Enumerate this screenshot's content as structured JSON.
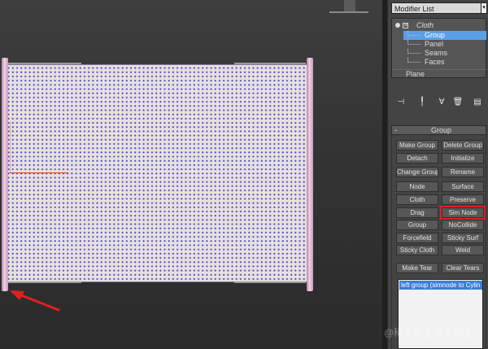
{
  "modifier_list": {
    "label": "Modifier List",
    "arrow": "▾"
  },
  "stack": {
    "root": "Cloth",
    "sub_objects": [
      "Group",
      "Panel",
      "Seams",
      "Faces"
    ],
    "selected_index": 0,
    "base": "Plane",
    "plus_glyph": "⊞"
  },
  "toolbar_icons": [
    "pin-stack-icon",
    "show-end-result-icon",
    "make-unique-icon",
    "remove-modifier-icon",
    "configure-sets-icon"
  ],
  "rollout": {
    "collapse": "-",
    "title": "Group",
    "buttons": [
      [
        "Make Group",
        "Delete Group"
      ],
      [
        "Detach",
        "Initialize"
      ],
      [
        "Change Group",
        "Rename"
      ],
      [
        "Node",
        "Surface"
      ],
      [
        "Cloth",
        "Preserve"
      ],
      [
        "Drag",
        "Sim Node"
      ],
      [
        "Group",
        "NoCollide"
      ],
      [
        "Forcefield",
        "Sticky Surf"
      ],
      [
        "Sticky Cloth",
        "Weld"
      ],
      [
        "Make Tear",
        "Clear Tears"
      ]
    ],
    "highlighted": "Sim Node",
    "group_list": [
      "left group (simnode  to  Cylin"
    ]
  },
  "watermark": "@稀土掘金技术社区",
  "colors": {
    "highlight_outline": "#e21f1f",
    "selection": "#5aa0e8",
    "cloth_dots": "#4b4fd0",
    "annotation_arrow": "#e02020"
  }
}
